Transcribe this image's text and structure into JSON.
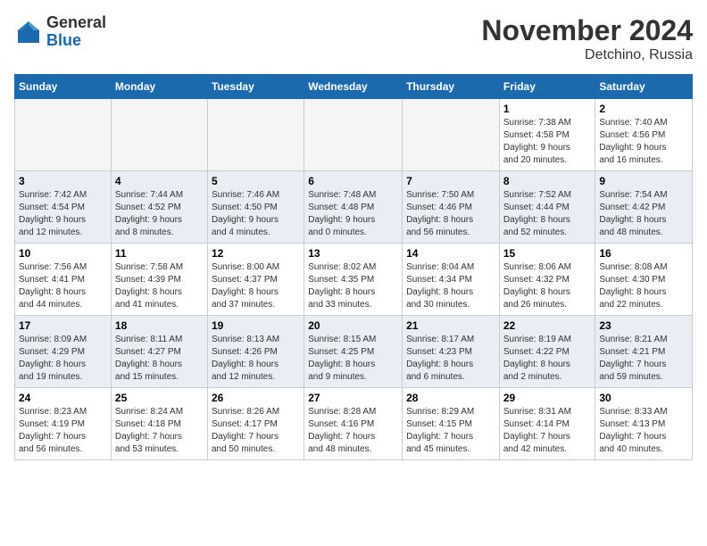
{
  "header": {
    "logo_general": "General",
    "logo_blue": "Blue",
    "month_title": "November 2024",
    "location": "Detchino, Russia"
  },
  "calendar": {
    "days_of_week": [
      "Sunday",
      "Monday",
      "Tuesday",
      "Wednesday",
      "Thursday",
      "Friday",
      "Saturday"
    ],
    "weeks": [
      {
        "days": [
          {
            "date": "",
            "info": ""
          },
          {
            "date": "",
            "info": ""
          },
          {
            "date": "",
            "info": ""
          },
          {
            "date": "",
            "info": ""
          },
          {
            "date": "",
            "info": ""
          },
          {
            "date": "1",
            "info": "Sunrise: 7:38 AM\nSunset: 4:58 PM\nDaylight: 9 hours\nand 20 minutes."
          },
          {
            "date": "2",
            "info": "Sunrise: 7:40 AM\nSunset: 4:56 PM\nDaylight: 9 hours\nand 16 minutes."
          }
        ]
      },
      {
        "days": [
          {
            "date": "3",
            "info": "Sunrise: 7:42 AM\nSunset: 4:54 PM\nDaylight: 9 hours\nand 12 minutes."
          },
          {
            "date": "4",
            "info": "Sunrise: 7:44 AM\nSunset: 4:52 PM\nDaylight: 9 hours\nand 8 minutes."
          },
          {
            "date": "5",
            "info": "Sunrise: 7:46 AM\nSunset: 4:50 PM\nDaylight: 9 hours\nand 4 minutes."
          },
          {
            "date": "6",
            "info": "Sunrise: 7:48 AM\nSunset: 4:48 PM\nDaylight: 9 hours\nand 0 minutes."
          },
          {
            "date": "7",
            "info": "Sunrise: 7:50 AM\nSunset: 4:46 PM\nDaylight: 8 hours\nand 56 minutes."
          },
          {
            "date": "8",
            "info": "Sunrise: 7:52 AM\nSunset: 4:44 PM\nDaylight: 8 hours\nand 52 minutes."
          },
          {
            "date": "9",
            "info": "Sunrise: 7:54 AM\nSunset: 4:42 PM\nDaylight: 8 hours\nand 48 minutes."
          }
        ]
      },
      {
        "days": [
          {
            "date": "10",
            "info": "Sunrise: 7:56 AM\nSunset: 4:41 PM\nDaylight: 8 hours\nand 44 minutes."
          },
          {
            "date": "11",
            "info": "Sunrise: 7:58 AM\nSunset: 4:39 PM\nDaylight: 8 hours\nand 41 minutes."
          },
          {
            "date": "12",
            "info": "Sunrise: 8:00 AM\nSunset: 4:37 PM\nDaylight: 8 hours\nand 37 minutes."
          },
          {
            "date": "13",
            "info": "Sunrise: 8:02 AM\nSunset: 4:35 PM\nDaylight: 8 hours\nand 33 minutes."
          },
          {
            "date": "14",
            "info": "Sunrise: 8:04 AM\nSunset: 4:34 PM\nDaylight: 8 hours\nand 30 minutes."
          },
          {
            "date": "15",
            "info": "Sunrise: 8:06 AM\nSunset: 4:32 PM\nDaylight: 8 hours\nand 26 minutes."
          },
          {
            "date": "16",
            "info": "Sunrise: 8:08 AM\nSunset: 4:30 PM\nDaylight: 8 hours\nand 22 minutes."
          }
        ]
      },
      {
        "days": [
          {
            "date": "17",
            "info": "Sunrise: 8:09 AM\nSunset: 4:29 PM\nDaylight: 8 hours\nand 19 minutes."
          },
          {
            "date": "18",
            "info": "Sunrise: 8:11 AM\nSunset: 4:27 PM\nDaylight: 8 hours\nand 15 minutes."
          },
          {
            "date": "19",
            "info": "Sunrise: 8:13 AM\nSunset: 4:26 PM\nDaylight: 8 hours\nand 12 minutes."
          },
          {
            "date": "20",
            "info": "Sunrise: 8:15 AM\nSunset: 4:25 PM\nDaylight: 8 hours\nand 9 minutes."
          },
          {
            "date": "21",
            "info": "Sunrise: 8:17 AM\nSunset: 4:23 PM\nDaylight: 8 hours\nand 6 minutes."
          },
          {
            "date": "22",
            "info": "Sunrise: 8:19 AM\nSunset: 4:22 PM\nDaylight: 8 hours\nand 2 minutes."
          },
          {
            "date": "23",
            "info": "Sunrise: 8:21 AM\nSunset: 4:21 PM\nDaylight: 7 hours\nand 59 minutes."
          }
        ]
      },
      {
        "days": [
          {
            "date": "24",
            "info": "Sunrise: 8:23 AM\nSunset: 4:19 PM\nDaylight: 7 hours\nand 56 minutes."
          },
          {
            "date": "25",
            "info": "Sunrise: 8:24 AM\nSunset: 4:18 PM\nDaylight: 7 hours\nand 53 minutes."
          },
          {
            "date": "26",
            "info": "Sunrise: 8:26 AM\nSunset: 4:17 PM\nDaylight: 7 hours\nand 50 minutes."
          },
          {
            "date": "27",
            "info": "Sunrise: 8:28 AM\nSunset: 4:16 PM\nDaylight: 7 hours\nand 48 minutes."
          },
          {
            "date": "28",
            "info": "Sunrise: 8:29 AM\nSunset: 4:15 PM\nDaylight: 7 hours\nand 45 minutes."
          },
          {
            "date": "29",
            "info": "Sunrise: 8:31 AM\nSunset: 4:14 PM\nDaylight: 7 hours\nand 42 minutes."
          },
          {
            "date": "30",
            "info": "Sunrise: 8:33 AM\nSunset: 4:13 PM\nDaylight: 7 hours\nand 40 minutes."
          }
        ]
      }
    ]
  }
}
